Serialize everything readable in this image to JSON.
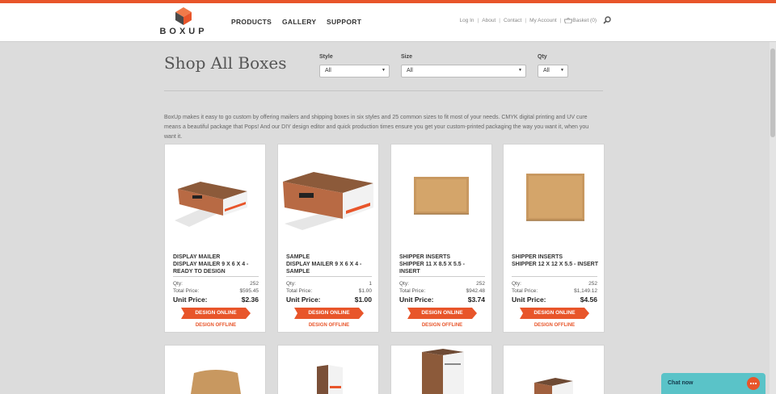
{
  "brand": {
    "name": "BOXUP",
    "accent": "#e8552a"
  },
  "nav": {
    "products": "PRODUCTS",
    "gallery": "GALLERY",
    "support": "SUPPORT"
  },
  "utility": {
    "login": "Log In",
    "about": "About",
    "contact": "Contact",
    "account": "My Account",
    "basket": "Basket (0)",
    "separator": "|"
  },
  "icons": {
    "search": "search-icon",
    "basket": "basket-icon",
    "chat": "chat-bubble-icon"
  },
  "page": {
    "title": "Shop All Boxes",
    "intro": "BoxUp makes it easy to go custom by offering mailers and shipping boxes in six styles and 25 common sizes to fit most of your needs. CMYK digital printing and UV cure means a beautiful package that Pops! And our DIY design editor and quick production times ensure you get your custom-printed packaging the way you want it, when you want it."
  },
  "filters": {
    "style": {
      "label": "Style",
      "value": "All"
    },
    "size": {
      "label": "Size",
      "value": "All"
    },
    "qty": {
      "label": "Qty",
      "value": "All"
    }
  },
  "labels": {
    "qty": "Qty:",
    "total": "Total Price:",
    "unit": "Unit Price:",
    "design_online": "DESIGN ONLINE",
    "design_offline": "DESIGN OFFLINE"
  },
  "products": [
    {
      "category": "DISPLAY MAILER",
      "name": "DISPLAY MAILER 9 X 6 X 4 - READY TO DESIGN",
      "qty": "252",
      "total": "$595.45",
      "unit": "$2.36",
      "image": "printed-display-mailer"
    },
    {
      "category": "SAMPLE",
      "name": "DISPLAY MAILER 9 X 6 X 4 - SAMPLE",
      "qty": "1",
      "total": "$1.00",
      "unit": "$1.00",
      "image": "printed-display-mailer"
    },
    {
      "category": "SHIPPER INSERTS",
      "name": "SHIPPER 11 X 8.5 X 5.5 - INSERT",
      "qty": "252",
      "total": "$942.48",
      "unit": "$3.74",
      "image": "kraft-insert"
    },
    {
      "category": "SHIPPER INSERTS",
      "name": "SHIPPER 12 X 12 X 5.5 - INSERT",
      "qty": "252",
      "total": "$1,149.12",
      "unit": "$4.56",
      "image": "kraft-insert"
    }
  ],
  "chat": {
    "label": "Chat now"
  }
}
